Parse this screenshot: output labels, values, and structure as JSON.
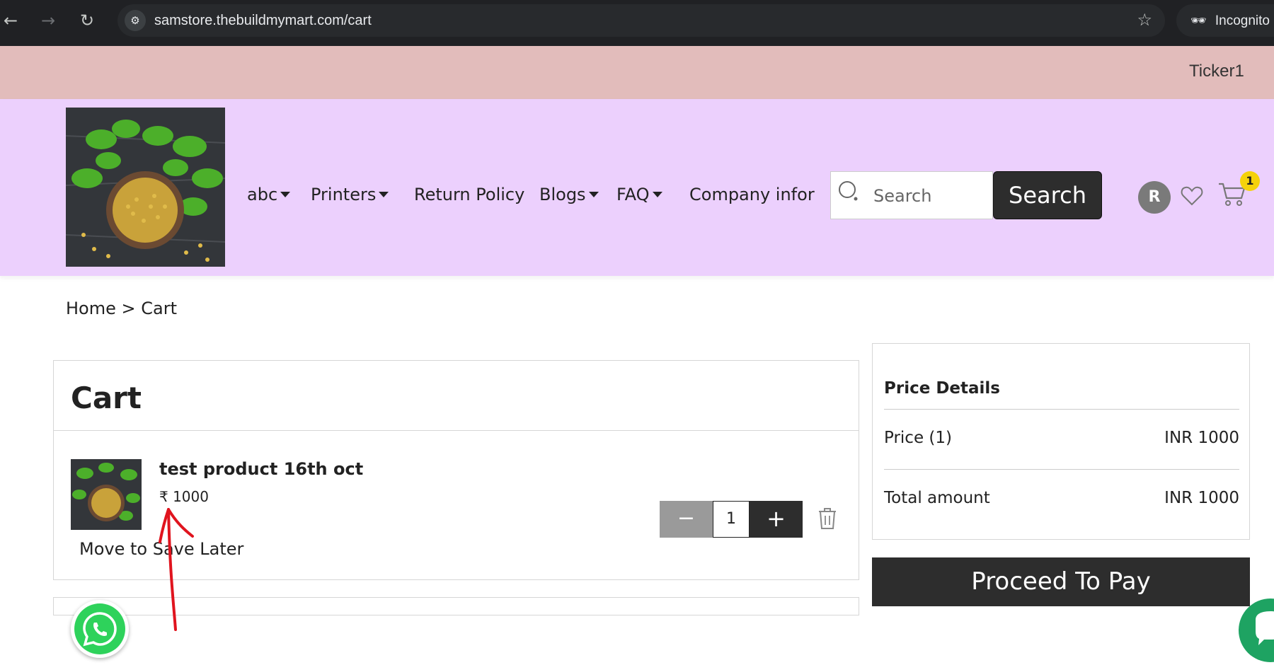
{
  "browser": {
    "url": "samstore.thebuildmymart.com/cart",
    "profile_label": "Incognito ("
  },
  "ticker": {
    "text": "Ticker1"
  },
  "header": {
    "nav": [
      {
        "label": "abc",
        "has_dropdown": true
      },
      {
        "label": "Printers",
        "has_dropdown": true
      },
      {
        "label": "Return Policy",
        "has_dropdown": false
      },
      {
        "label": "Blogs",
        "has_dropdown": true
      },
      {
        "label": "FAQ",
        "has_dropdown": true
      },
      {
        "label": "Company infor",
        "has_dropdown": false
      }
    ],
    "search_placeholder": "Search",
    "search_button": "Search",
    "avatar_initial": "R",
    "cart_count": "1"
  },
  "breadcrumb": {
    "home": "Home",
    "separator": ">",
    "current": "Cart"
  },
  "cart": {
    "title": "Cart",
    "items": [
      {
        "name": "test product 16th oct",
        "price": "₹ 1000",
        "quantity": "1",
        "save_later_label": "Move to Save Later"
      }
    ],
    "minus_label": "−",
    "plus_label": "+"
  },
  "price_details": {
    "title": "Price Details",
    "price_label": "Price (1)",
    "price_value": "INR 1000",
    "total_label": "Total amount",
    "total_value": "INR 1000"
  },
  "proceed_label": "Proceed To Pay",
  "colors": {
    "ticker_bg": "#e2bcbb",
    "header_bg": "#ecd0fd",
    "dark_button": "#2d2d2d",
    "badge": "#f5d20a",
    "annotation": "#e0141e",
    "whatsapp": "#2ed25b"
  }
}
